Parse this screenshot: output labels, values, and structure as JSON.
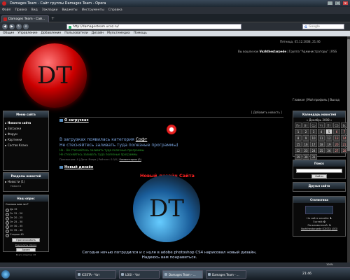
{
  "browser": {
    "window_title": "Damages Team - Сайт группы Damages Team - Opera",
    "menu": [
      "Файл",
      "Правка",
      "Вид",
      "Закладки",
      "Виджеты",
      "Инструменты",
      "Справка"
    ],
    "tab_title": "Damages Team - Сай...",
    "tab_add": "+",
    "nav": {
      "back": "◀",
      "forward": "▶",
      "reload": "↻",
      "home": "⌂"
    },
    "url": "http://damagesteam.ucoz.ru/",
    "search_placeholder": "Google",
    "search_engine": "G",
    "bookmarks": [
      "Общие",
      "Управление",
      "Добавление",
      "Пользователи",
      "Дизайн",
      "Мультимедиа",
      "Помощь"
    ],
    "window_buttons": {
      "min": "_",
      "max": "□",
      "close": "x"
    }
  },
  "site": {
    "logo_text": "DT",
    "date": "Пятница, 05.12.2008, 21:46",
    "greeting_prefix": "Вы вошли как",
    "username": "Vozhthestarpede",
    "group_text": "| Группа \"Администраторы\" | RSS",
    "header_links": "Главная | Мой профиль | Выход",
    "sidebar": {
      "menu_title": "Меню сайта",
      "menu_items": [
        "Новости сайта",
        "Загрузки",
        "Форум",
        "Картинки",
        "Состав Клана"
      ],
      "news_sections_title": "Разделы новостей",
      "news_sections_item": "Новости (1)",
      "news_sections_sub": "Новости",
      "poll_title": "Наш опрос",
      "poll_question": "Сколько вам лет?",
      "poll_options": [
        "До 15",
        "От 15 - 20",
        "От 20 - 25",
        "От 25 - 30",
        "От 30 - 35",
        "От 35 - 40",
        "Старше 40"
      ],
      "poll_vote_button": "Проголосовать",
      "poll_results": "Результаты опроса",
      "poll_archive": "Архив опросов",
      "poll_total": "Всего ответов: 28"
    },
    "main": {
      "add_news": "[ Добавить новость ]",
      "post1_title": "О загрузках",
      "post1_line1_prefix": "В загрузках появилась категория",
      "post1_line1_link": "Софт",
      "post1_line2": "Не стесняйтесь заливать туда полезные программы)",
      "post1_green1": "На - ",
      "post1_green2": "Не стесняйтесь заливать туда полезные программы",
      "post1_meta": "Просмотров: 4 | Дата: Вчера | Рейтинг: 0.0/0 |",
      "post1_comments": "Комментарии (0)",
      "post2_title": "Новый дизайн",
      "post2_red_title": "Новый дизайн Сайта",
      "post2_text": "Сегодня ночью потрудился и с нуля в adobe photoshop CS4 нарисовал новый дизайн, Надеюсь вам понравиться."
    },
    "right": {
      "calendar_title": "Календарь новостей",
      "calendar_month": "« Декабрь 2008 »",
      "weekdays": [
        "Пн",
        "Вт",
        "Ср",
        "Чт",
        "Пт",
        "Сб",
        "Вс"
      ],
      "days": [
        "1",
        "2",
        "3",
        "4",
        "5",
        "6",
        "7",
        "8",
        "9",
        "10",
        "11",
        "12",
        "13",
        "14",
        "15",
        "16",
        "17",
        "18",
        "19",
        "20",
        "21",
        "22",
        "23",
        "24",
        "25",
        "26",
        "27",
        "28",
        "29",
        "30",
        "31"
      ],
      "today": "5",
      "search_title": "Поиск",
      "search_button": "Найти",
      "friends_title": "Друзья сайта",
      "stats_title": "Статистика",
      "online_total_label": "На сайте онлайн:",
      "online_total": "1",
      "guests_label": "Гостей:",
      "guests": "0",
      "users_label": "Пользователей:",
      "users": "1",
      "online_users": "Vozhthestarpede",
      "online_users2": "ICESTA",
      "online_users3": "LOGI"
    }
  },
  "statusbar": {
    "zoom": "100%"
  },
  "taskbar": {
    "items": [
      "ICESTA - Чат",
      "LOGI - Чат",
      "Damages Team - ...",
      "Damages Team - ..."
    ],
    "clock": "21:46"
  }
}
